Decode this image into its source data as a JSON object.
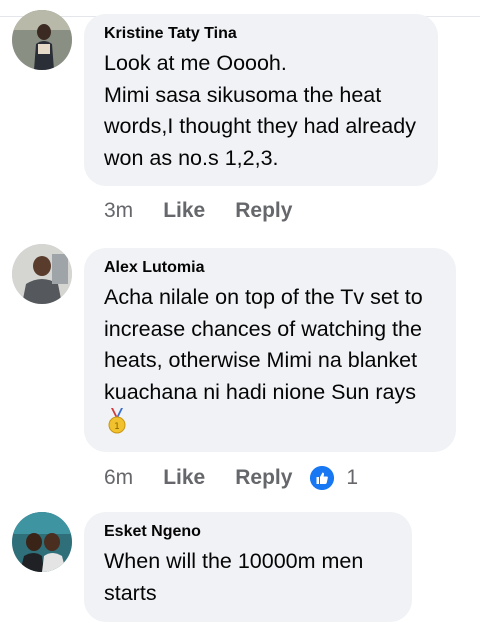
{
  "comments": [
    {
      "author": "Kristine Taty Tina",
      "text": "Look at me Ooooh.\nMimi sasa sikusoma the heat words,I thought  they had already won as no.s 1,2,3.",
      "time": "3m",
      "like_label": "Like",
      "reply_label": "Reply"
    },
    {
      "author": "Alex Lutomia",
      "text": "Acha nilale on top of the Tv set to increase chances of watching the heats, otherwise Mimi na blanket kuachana ni hadi nione Sun rays",
      "emoji": "medal-icon",
      "time": "6m",
      "like_label": "Like",
      "reply_label": "Reply",
      "reaction": {
        "icon": "thumbs-up-icon",
        "count": "1",
        "color": "#1877f2"
      }
    },
    {
      "author": "Esket Ngeno",
      "text": "When will the 10000m men starts"
    }
  ]
}
